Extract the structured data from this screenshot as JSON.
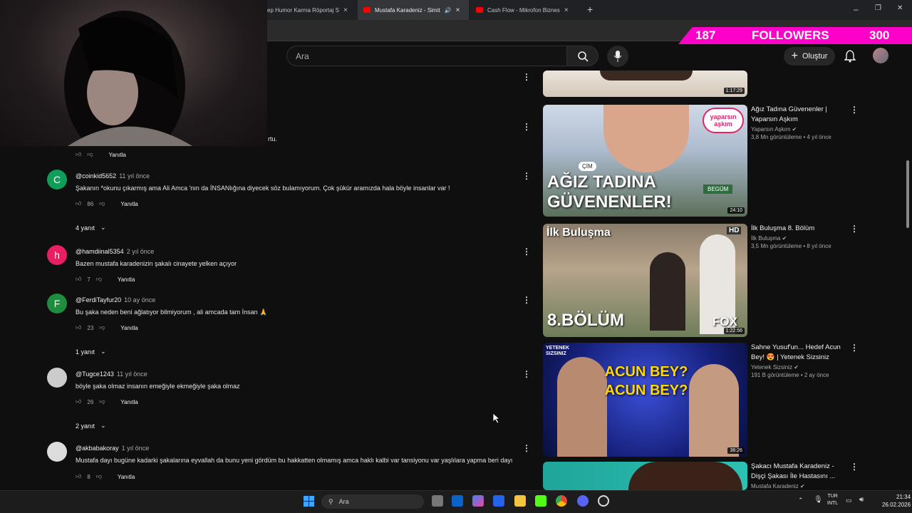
{
  "browser": {
    "tabs": [
      {
        "label": "ep Humor Karma Röportaj S",
        "close": "×"
      },
      {
        "label": "Mustafa Karadeniz - Simit",
        "close": "×"
      },
      {
        "label": "Cash Flow - Mikrofon Biznes",
        "close": "×"
      }
    ],
    "new_tab": "+",
    "window_controls": [
      "–",
      "❐",
      "✕"
    ]
  },
  "overlay": {
    "count_left": "187",
    "label": "FOLLOWERS",
    "count_right": "300"
  },
  "header": {
    "search_placeholder": "Ara",
    "create_label": "Oluştur"
  },
  "partial_text": "rtu.",
  "top_actions": {
    "reply": "Yanıtla"
  },
  "comments": [
    {
      "initial": "C",
      "avatar_color": "#0f9d58",
      "handle": "@coinkid5652",
      "time": "11 yıl önce",
      "text": "Şakanın *okunu çıkarmış ama Ali Amca 'nın da İNSANlığına diyecek söz bulamıyorum. Çok şükür aramızda hala böyle insanlar var !",
      "likes": "86",
      "reply": "Yanıtla",
      "replies": "4 yanıt"
    },
    {
      "initial": "h",
      "avatar_color": "#e91e63",
      "handle": "@hamdiinal5354",
      "time": "2 yıl önce",
      "text": "Bazen mustafa karadenizin şakalı cinayete yelken açıyor",
      "likes": "7",
      "reply": "Yanıtla",
      "replies": ""
    },
    {
      "initial": "F",
      "avatar_color": "#1e8e3e",
      "handle": "@FerdiTayfur20",
      "time": "10 ay önce",
      "text": "Bu şaka neden beni ağlatıyor bilmiyorum , ali amcada tam İnsan 🙏",
      "likes": "23",
      "reply": "Yanıtla",
      "replies": "1 yanıt"
    },
    {
      "initial": "",
      "avatar_color": "#cccccc",
      "handle": "@Tugce1243",
      "time": "11 yıl önce",
      "text": "böyle şaka olmaz insanın emeğiyle ekmeğiyle şaka olmaz",
      "likes": "26",
      "reply": "Yanıtla",
      "replies": "2 yanıt"
    },
    {
      "initial": "",
      "avatar_color": "#dddddd",
      "handle": "@akbabakoray",
      "time": "1 yıl önce",
      "text": "Mustafa dayı bugüne kadarki şakalarına eyvallah da bunu yeni gördüm bu hakkatten olmamış amca haklı kalbi var tansiyonu var yaşlılara yapma beri dayı",
      "likes": "8",
      "reply": "Yanıtla",
      "replies": ""
    }
  ],
  "sidebar": [
    {
      "title": "",
      "channel": "",
      "meta": "",
      "duration": "1:17:29"
    },
    {
      "title": "Ağız Tadına Güvenenler | Yaparsın Aşkım",
      "channel": "Yaparsın Aşkım",
      "meta": "3,8 Mn görüntüleme • 4 yıl önce",
      "duration": "24:10",
      "thumb_text": "AĞIZ TADINA GÜVENENLER!",
      "badge": "yaparsın aşkım",
      "tag1": "ÇİM",
      "tag2": "BEGÜM"
    },
    {
      "title": "İlk Buluşma 8. Bölüm",
      "channel": "İlk Buluşma",
      "meta": "3,5 Mn görüntüleme • 8 yıl önce",
      "duration": "1:22:56",
      "thumb_text": "İlk Buluşma",
      "episode": "8.BÖLÜM",
      "logo": "FOX",
      "hd": "HD"
    },
    {
      "title": "Sahne Yusuf'un... Hedef Acun Bey! 😍 | Yetenek Sizsiniz",
      "channel": "Yetenek Sizsiniz",
      "meta": "191 B görüntüleme • 2 ay önce",
      "duration": "36:26",
      "thumb_text": "ACUN BEY? ACUN BEY?",
      "badge": "YETENEK SIZSINIZ"
    },
    {
      "title": "Şakacı Mustafa Karadeniz - Dişçi Şakası İle Hastasını ...",
      "channel": "Mustafa Karadeniz",
      "meta": "",
      "duration": ""
    }
  ],
  "taskbar": {
    "search": "Ara",
    "lang1": "TUR",
    "lang2": "INTL",
    "time": "21:34",
    "date": "26.02.2026"
  },
  "colors": {
    "overlay": "#ff00c8",
    "bg": "#0f0f0f"
  }
}
